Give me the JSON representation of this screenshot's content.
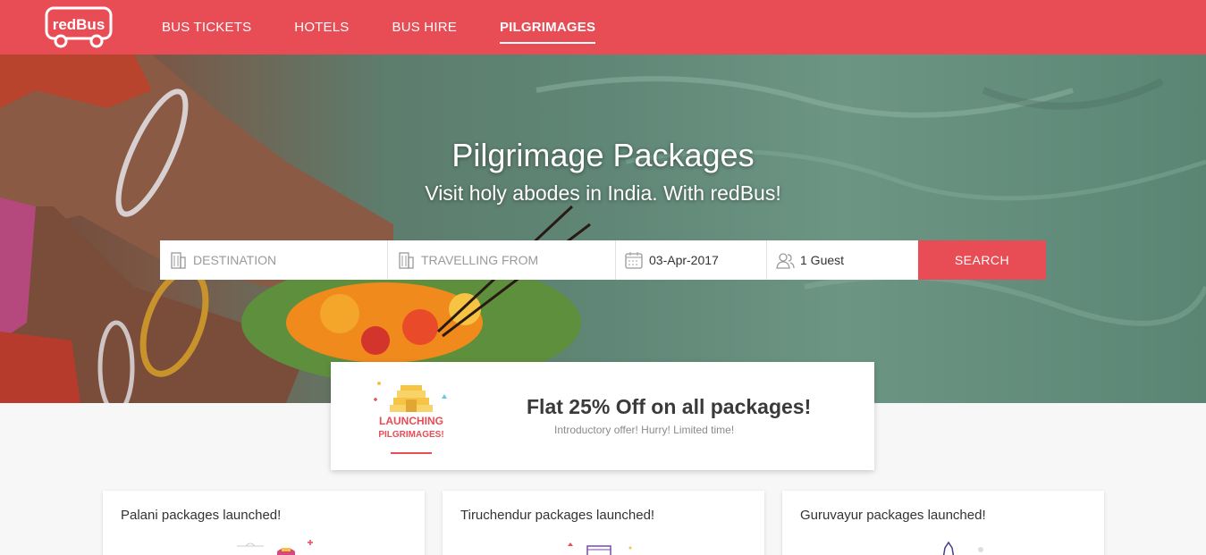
{
  "header": {
    "logo_text": "redBus",
    "nav": [
      {
        "label": "BUS TICKETS",
        "active": false
      },
      {
        "label": "HOTELS",
        "active": false
      },
      {
        "label": "BUS HIRE",
        "active": false
      },
      {
        "label": "PILGRIMAGES",
        "active": true
      }
    ]
  },
  "hero": {
    "title": "Pilgrimage Packages",
    "subtitle": "Visit holy abodes in India. With redBus!"
  },
  "search": {
    "destination_placeholder": "DESTINATION",
    "from_placeholder": "TRAVELLING FROM",
    "date_value": "03-Apr-2017",
    "guests_value": "1 Guest",
    "button_label": "SEARCH",
    "icons": [
      "building-icon",
      "building-icon",
      "calendar-icon",
      "user-icon"
    ]
  },
  "promo": {
    "badge_line1": "LAUNCHING",
    "badge_line2": "PILGRIMAGES!",
    "title": "Flat 25% Off on all packages!",
    "subtitle": "Introductory offer! Hurry! Limited time!"
  },
  "cards": [
    {
      "title": "Palani packages launched!"
    },
    {
      "title": "Tiruchendur packages launched!"
    },
    {
      "title": "Guruvayur packages launched!"
    }
  ],
  "colors": {
    "brand": "#e84c55",
    "accent_yellow": "#f6c343"
  }
}
